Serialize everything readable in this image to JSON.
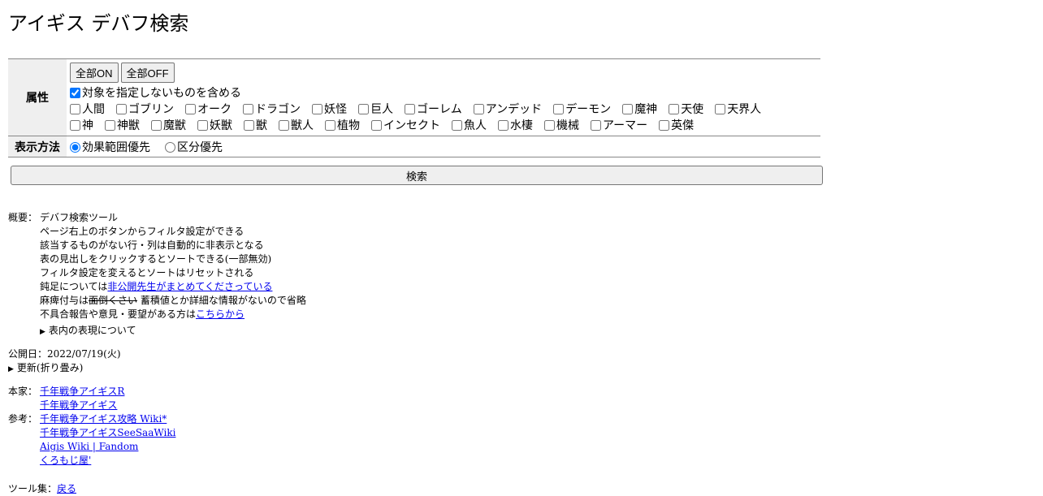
{
  "page": {
    "title": "アイギス デバフ検索"
  },
  "filters": {
    "attr_label": "属性",
    "all_on": "全部ON",
    "all_off": "全部OFF",
    "include_untargeted": {
      "label": "対象を指定しないものを含める",
      "checked": true
    },
    "row1": [
      "人間",
      "ゴブリン",
      "オーク",
      "ドラゴン",
      "妖怪",
      "巨人",
      "ゴーレム",
      "アンデッド",
      "デーモン",
      "魔神",
      "天使",
      "天界人"
    ],
    "row2": [
      "神",
      "神獣",
      "魔獣",
      "妖獣",
      "獣",
      "獣人",
      "植物",
      "インセクト",
      "魚人",
      "水棲",
      "機械",
      "アーマー",
      "英傑"
    ],
    "display_label": "表示方法",
    "display_options": [
      "効果範囲優先",
      "区分優先"
    ],
    "display_selected": 0
  },
  "search_label": "検索",
  "summary": {
    "label": "概要：",
    "lines": [
      "デバフ検索ツール",
      "ページ右上のボタンからフィルタ設定ができる",
      "該当するものがない行・列は自動的に非表示となる",
      "表の見出しをクリックするとソートできる(一部無効)",
      "フィルタ設定を変えるとソートはリセットされる"
    ],
    "slow_prefix": "鈍足については",
    "slow_link": "非公開先生がまとめてくださっている",
    "paralysis_prefix": "麻痺付与は",
    "paralysis_strike": "面倒くさい",
    "paralysis_suffix": "蓄積値とか詳細な情報がないので省略",
    "report_prefix": "不具合報告や意見・要望がある方は",
    "report_link": "こちらから",
    "expr_toggle": "表内の表現について"
  },
  "published": "公開日：2022/07/19(火)",
  "update_toggle": "更新(折り畳み)",
  "home": {
    "label": "本家：",
    "links": [
      "千年戦争アイギスR",
      "千年戦争アイギス"
    ]
  },
  "reference": {
    "label": "参考：",
    "links": [
      "千年戦争アイギス攻略 Wiki*",
      "千年戦争アイギスSeeSaaWiki",
      "Aigis Wiki | Fandom",
      "くろもじ屋'"
    ]
  },
  "tools": {
    "label": "ツール集：",
    "link": "戻る"
  }
}
